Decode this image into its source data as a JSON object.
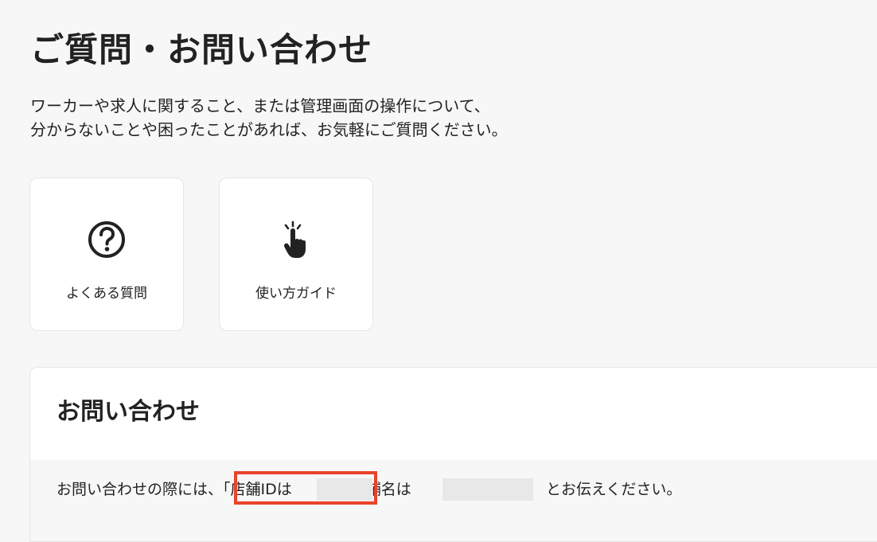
{
  "page": {
    "title": "ご質問・お問い合わせ",
    "description_line1": "ワーカーや求人に関すること、または管理画面の操作について、",
    "description_line2": "分からないことや困ったことがあれば、お気軽にご質問ください。"
  },
  "cards": {
    "faq": {
      "label": "よくある質問",
      "icon": "question-circle-icon"
    },
    "guide": {
      "label": "使い方ガイド",
      "icon": "tap-hand-icon"
    }
  },
  "contact": {
    "title": "お問い合わせ",
    "note_prefix": "お問い合わせの際には、「店舗IDは",
    "note_middle": "店舗名は",
    "note_suffix": "とお伝えください。"
  },
  "colors": {
    "background": "#f7f7f7",
    "card": "#ffffff",
    "text": "#222222",
    "highlight": "#e8432b",
    "redacted": "#e8e8e8"
  }
}
